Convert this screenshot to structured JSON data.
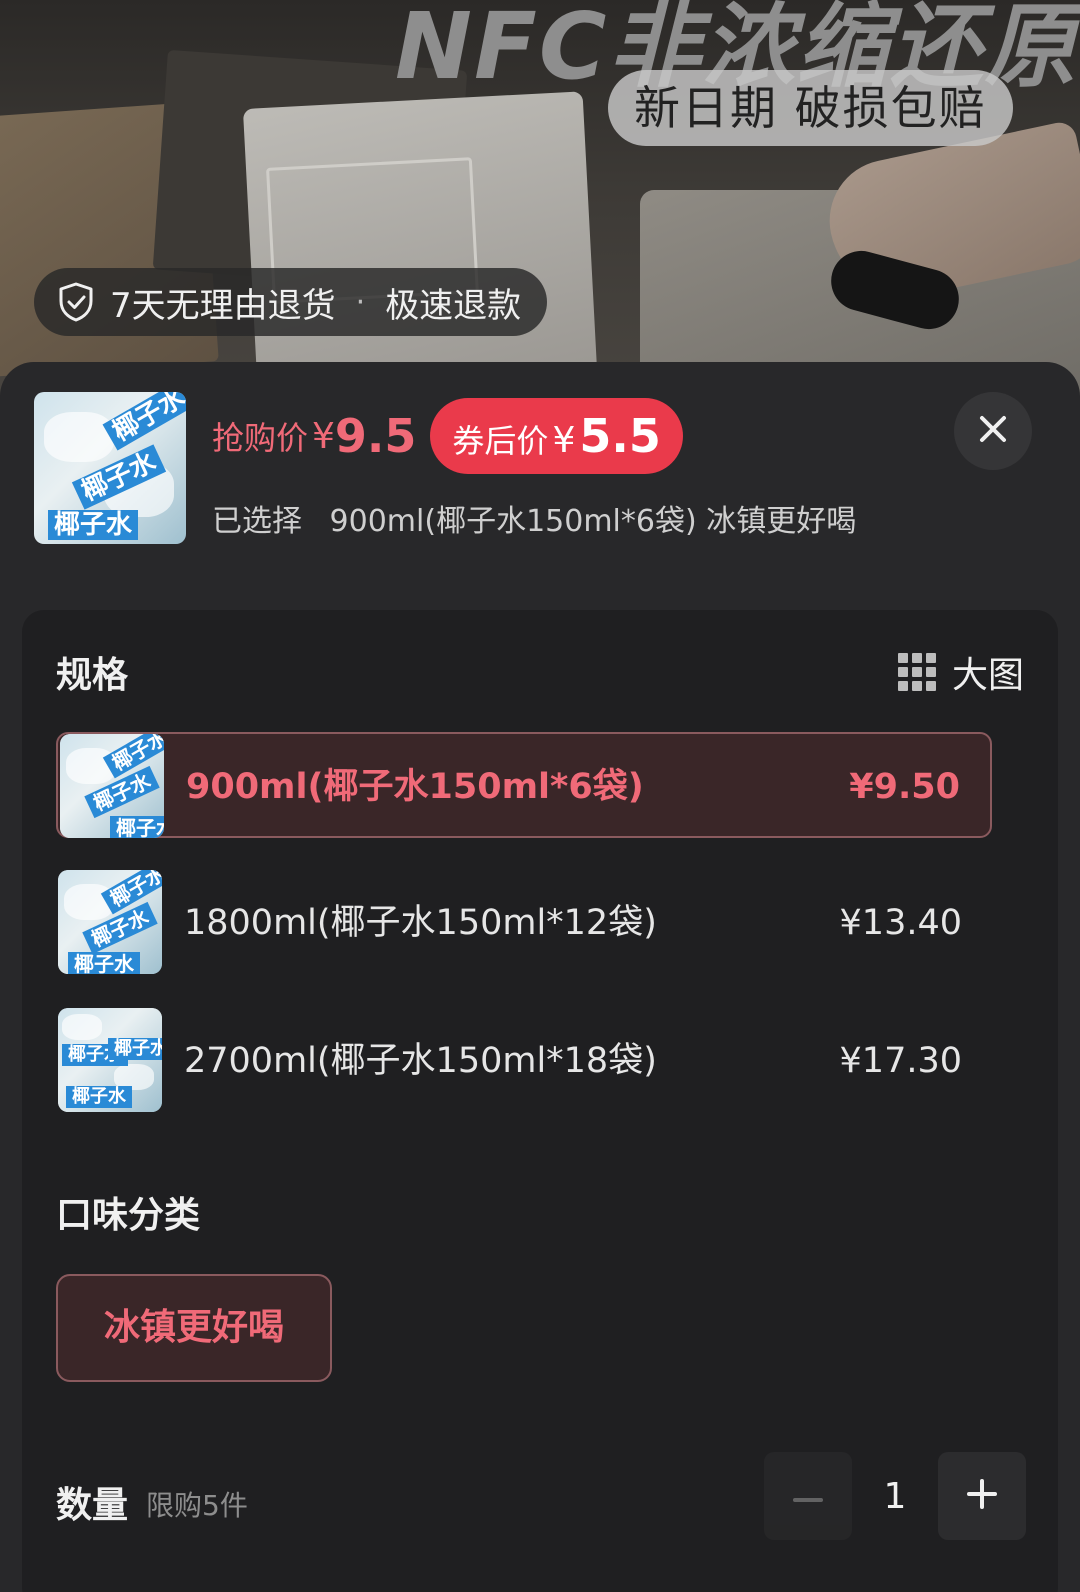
{
  "hero": {
    "title": "NFC非浓缩还原",
    "pill": "新日期  破损包赔",
    "badge": {
      "left": "7天无理由退货",
      "separator": "·",
      "right": "极速退款"
    }
  },
  "header": {
    "price_label": "抢购价",
    "price_currency": "¥",
    "price_value": "9.5",
    "coupon_label": "券后价",
    "coupon_currency": "¥",
    "coupon_value": "5.5",
    "selected_label": "已选择",
    "selected_value": "900ml(椰子水150ml*6袋) 冰镇更好喝",
    "thumb_text": "椰子水"
  },
  "spec": {
    "title": "规格",
    "big_image_label": "大图",
    "options": [
      {
        "name": "900ml(椰子水150ml*6袋)",
        "price": "¥9.50",
        "selected": true
      },
      {
        "name": "1800ml(椰子水150ml*12袋)",
        "price": "¥13.40",
        "selected": false
      },
      {
        "name": "2700ml(椰子水150ml*18袋)",
        "price": "¥17.30",
        "selected": false
      }
    ],
    "thumb_text": "椰子水"
  },
  "flavor": {
    "title": "口味分类",
    "options": [
      {
        "name": "冰镇更好喝",
        "selected": true
      }
    ]
  },
  "quantity": {
    "label": "数量",
    "limit": "限购5件",
    "value": "1"
  },
  "colors": {
    "accent": "#f06a78",
    "coupon_bg": "#ea3a4b",
    "sheet_bg": "#28282a",
    "card_bg": "#1f1f21"
  }
}
